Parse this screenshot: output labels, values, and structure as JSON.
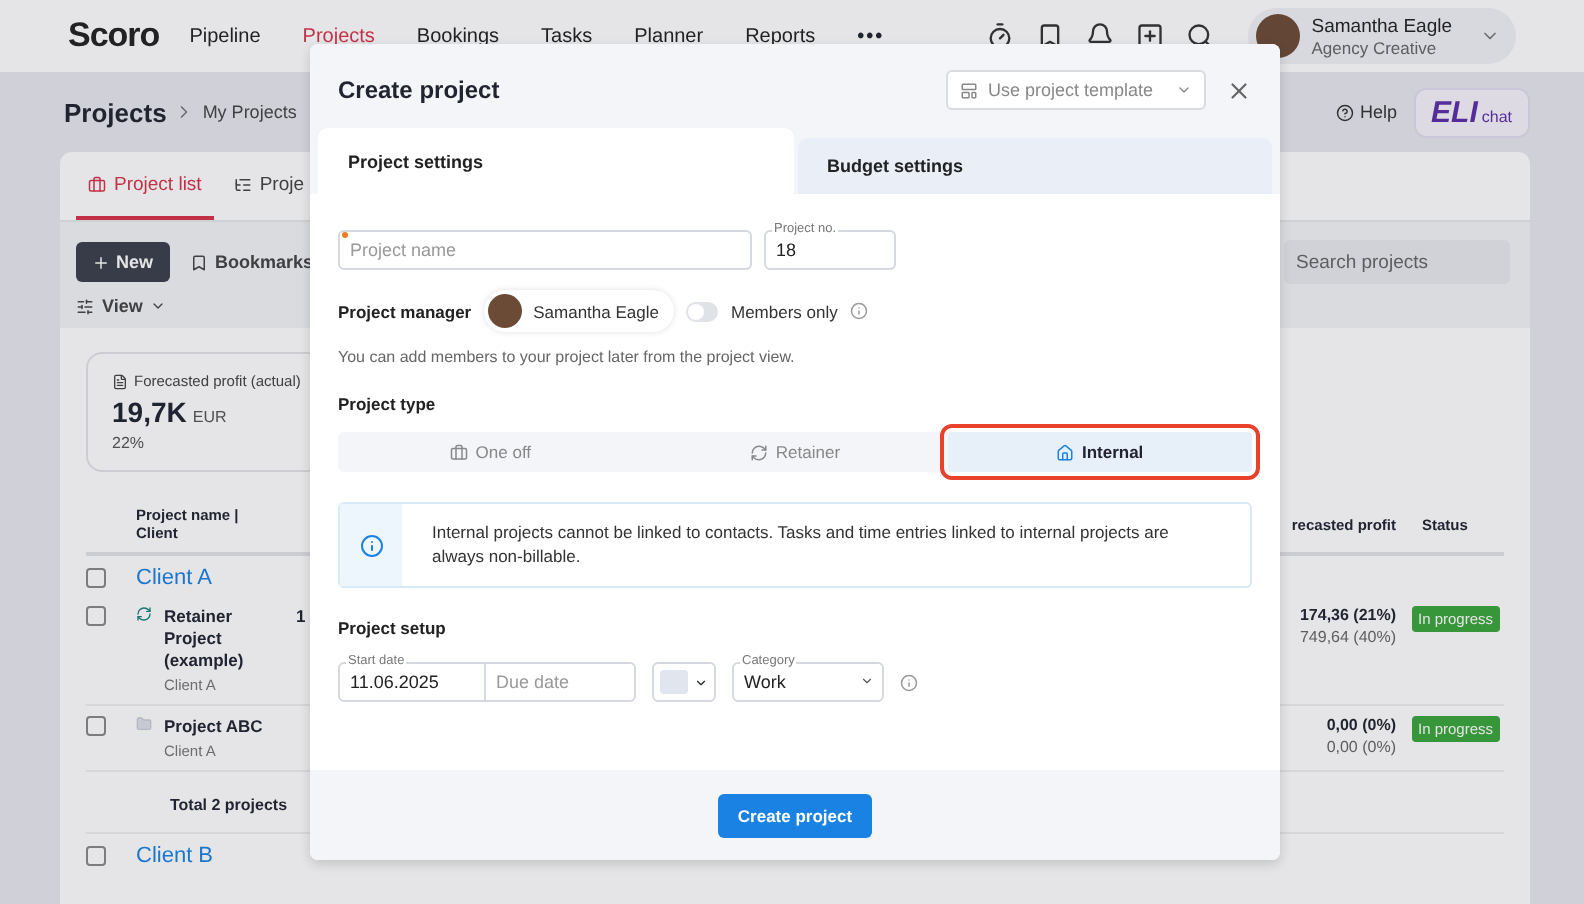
{
  "nav": {
    "logo": "Scoro",
    "items": [
      {
        "label": "Pipeline",
        "selected": false
      },
      {
        "label": "Projects",
        "selected": true
      },
      {
        "label": "Bookings",
        "selected": false
      },
      {
        "label": "Tasks",
        "selected": false
      },
      {
        "label": "Planner",
        "selected": false
      },
      {
        "label": "Reports",
        "selected": false
      }
    ],
    "more": "•••",
    "user": {
      "name": "Samantha Eagle",
      "role": "Agency Creative"
    }
  },
  "page": {
    "title": "Projects",
    "breadcrumb": "My Projects",
    "help": "Help",
    "eli": {
      "name": "ELI",
      "suffix": "chat"
    }
  },
  "tabs": [
    {
      "label": "Project list",
      "selected": true
    },
    {
      "label": "Proje",
      "selected": false
    }
  ],
  "toolbar": {
    "new_button": "New",
    "bookmarks": "Bookmarks",
    "view": "View",
    "search_placeholder": "Search projects"
  },
  "kpi": {
    "label": "Forecasted profit (actual)",
    "value": "19,7K",
    "unit": "EUR",
    "percent": "22%"
  },
  "table": {
    "columns": [
      "Project name | Client",
      "recasted profit",
      "Status"
    ],
    "groups": [
      {
        "client": "Client A",
        "checked": false,
        "rows": [
          {
            "kind": "retainer",
            "name": "Retainer Project (example)",
            "client": "Client A",
            "column_2": "1",
            "profit": "174,36 (21%)",
            "profit_sub": "749,64 (40%)",
            "status": "In progress",
            "checked": false
          },
          {
            "kind": "oneoff",
            "name": "Project ABC",
            "client": "Client A",
            "profit": "0,00 (0%)",
            "profit_sub": "0,00 (0%)",
            "status": "In progress",
            "checked": false
          }
        ],
        "total": "Total 2 projects"
      },
      {
        "client": "Client B",
        "checked": false
      }
    ]
  },
  "modal": {
    "title": "Create project",
    "template_placeholder": "Use project template",
    "tabs": [
      {
        "label": "Project settings",
        "selected": true
      },
      {
        "label": "Budget settings",
        "selected": false
      }
    ],
    "name_field": {
      "placeholder": "Project name",
      "required": true
    },
    "number_field": {
      "label": "Project no.",
      "value": "18"
    },
    "manager": {
      "label": "Project manager",
      "name": "Samantha Eagle"
    },
    "members_only": {
      "label": "Members only",
      "on": false
    },
    "hint": "You can add members to your project later from the project view.",
    "type_label": "Project type",
    "types": [
      {
        "kind": "oneoff",
        "label": "One off",
        "selected": false,
        "highlighted": false
      },
      {
        "kind": "retainer",
        "label": "Retainer",
        "selected": false,
        "highlighted": false
      },
      {
        "kind": "internal",
        "label": "Internal",
        "selected": true,
        "highlighted": true
      }
    ],
    "info": "Internal projects cannot be linked to contacts. Tasks and time entries linked to internal projects are always non-billable.",
    "setup_label": "Project setup",
    "start_date": {
      "label": "Start date",
      "value": "11.06.2025"
    },
    "due_date": {
      "placeholder": "Due date"
    },
    "category": {
      "label": "Category",
      "value": "Work"
    },
    "submit": "Create project"
  }
}
